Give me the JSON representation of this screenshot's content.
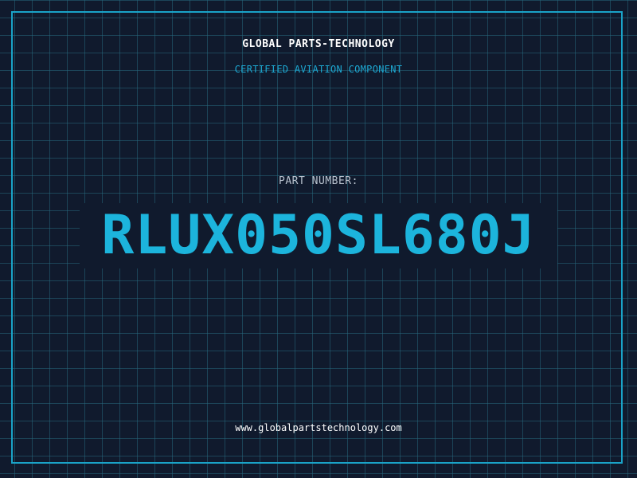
{
  "header": {
    "company": "GLOBAL PARTS-TECHNOLOGY",
    "subtitle": "CERTIFIED AVIATION COMPONENT"
  },
  "part": {
    "label": "PART NUMBER:",
    "number": "RLUX050SL680J"
  },
  "footer": {
    "website": "www.globalpartstechnology.com"
  },
  "colors": {
    "background": "#101a2d",
    "grid": "#26667c",
    "accent": "#1cb4dc",
    "frame": "#1aa3c8"
  }
}
